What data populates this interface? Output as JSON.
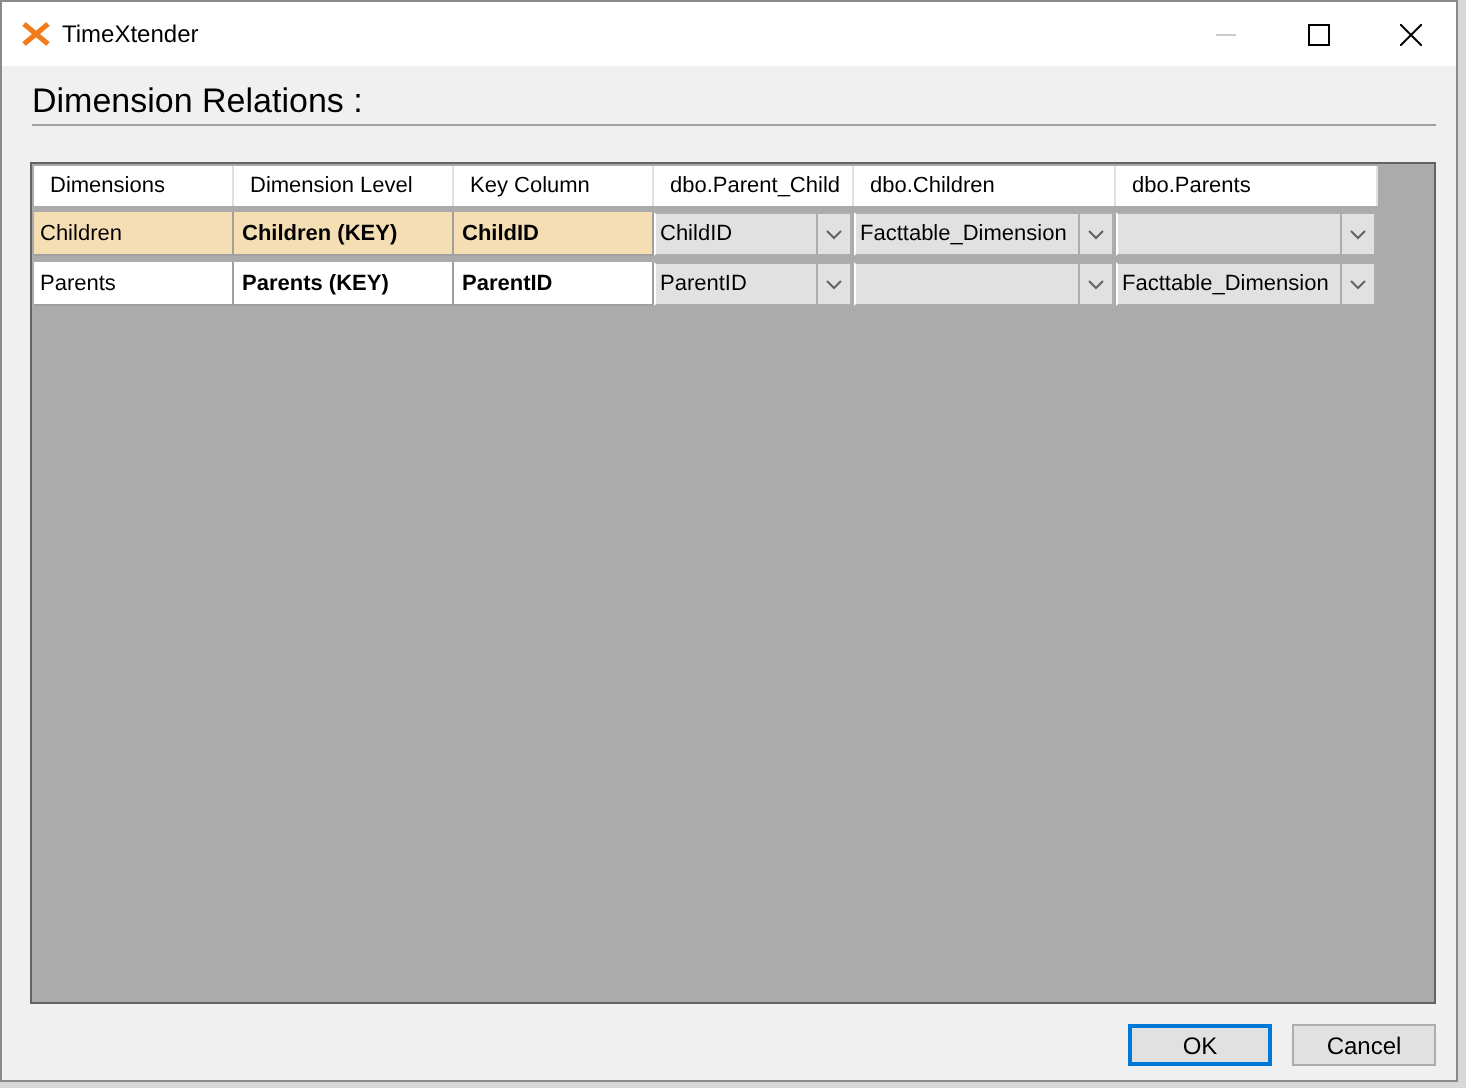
{
  "window": {
    "title": "TimeXtender"
  },
  "heading": "Dimension Relations :",
  "table": {
    "columns": [
      "Dimensions",
      "Dimension Level",
      "Key Column",
      "dbo.Parent_Child",
      "dbo.Children",
      "dbo.Parents"
    ],
    "rows": [
      {
        "selected": true,
        "dimension": "Children",
        "level": "Children (KEY)",
        "key": "ChildID",
        "relations": [
          {
            "kind": "dropdown",
            "value": "ChildID"
          },
          {
            "kind": "dropdown",
            "value": "Facttable_Dimension"
          },
          {
            "kind": "dropdown"
          }
        ]
      },
      {
        "selected": false,
        "dimension": "Parents",
        "level": "Parents (KEY)",
        "key": "ParentID",
        "relations": [
          {
            "kind": "dropdown",
            "value": "ParentID"
          },
          {
            "kind": "dropdown"
          },
          {
            "kind": "dropdown",
            "value": "Facttable_Dimension"
          }
        ]
      }
    ]
  },
  "buttons": [
    {
      "label": "OK",
      "focused": true
    },
    {
      "label": "Cancel",
      "focused": false
    }
  ]
}
